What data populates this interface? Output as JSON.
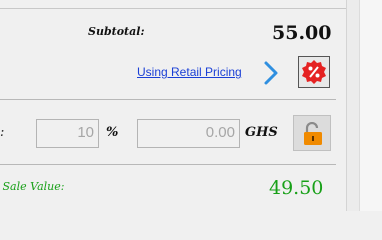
{
  "totals": {
    "subtotal_label": "Subtotal:",
    "subtotal_value": "55.00"
  },
  "pricing": {
    "link_label": "Using Retail Pricing",
    "chevron_icon": "chevron-right-icon",
    "discount_icon": "percent-badge-icon"
  },
  "discount": {
    "percent_value": "10",
    "percent_sign": "%",
    "amount_value": "0.00",
    "currency": "GHS",
    "lock_icon": "unlocked-padlock-icon"
  },
  "sale": {
    "label": "' Sale Value:",
    "value": "49.50"
  },
  "colors": {
    "link": "#1a3fd6",
    "chevron": "#2f8fe0",
    "discount_badge": "#e52222",
    "lock": "#f08a00",
    "sale_value": "#18a018"
  }
}
